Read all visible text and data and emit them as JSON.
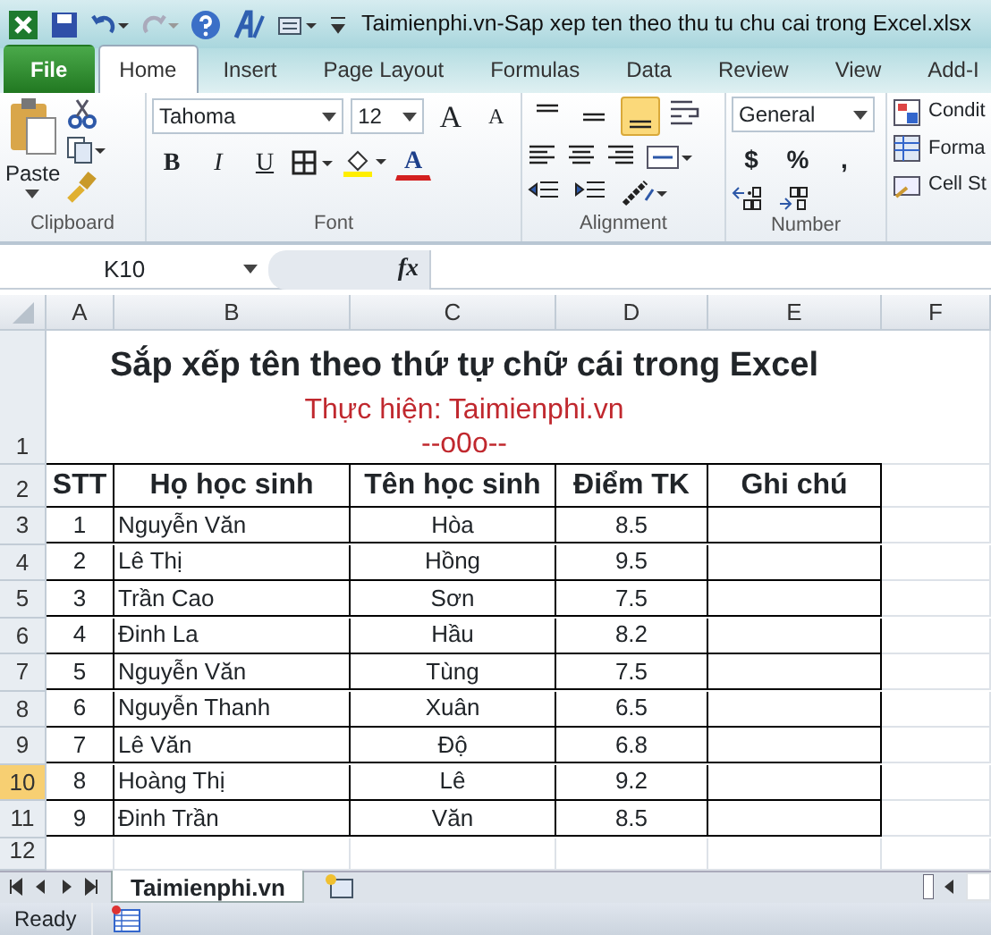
{
  "window": {
    "title": "Taimienphi.vn-Sap xep ten theo thu tu chu cai trong Excel.xlsx"
  },
  "tabs": [
    {
      "label": "File",
      "kind": "file",
      "selected": false
    },
    {
      "label": "Home",
      "kind": "tab",
      "selected": true
    },
    {
      "label": "Insert",
      "kind": "tab",
      "selected": false
    },
    {
      "label": "Page Layout",
      "kind": "tab",
      "selected": false
    },
    {
      "label": "Formulas",
      "kind": "tab",
      "selected": false
    },
    {
      "label": "Data",
      "kind": "tab",
      "selected": false
    },
    {
      "label": "Review",
      "kind": "tab",
      "selected": false
    },
    {
      "label": "View",
      "kind": "tab",
      "selected": false
    },
    {
      "label": "Add-I",
      "kind": "tab",
      "selected": false
    }
  ],
  "ribbon": {
    "clipboard": {
      "label": "Clipboard",
      "paste": "Paste"
    },
    "font": {
      "label": "Font",
      "name": "Tahoma",
      "size": "12",
      "grow": "A",
      "shrink": "A",
      "styles": [
        "B",
        "I",
        "U"
      ],
      "color_letter": "A"
    },
    "alignment": {
      "label": "Alignment",
      "buttons": [
        {
          "selected": false
        },
        {
          "selected": false
        },
        {
          "selected": true
        }
      ]
    },
    "number": {
      "label": "Number",
      "format": "General",
      "buttons": [
        "$",
        "%",
        ","
      ]
    },
    "styles": [
      "Condit",
      "Forma",
      "Cell St"
    ]
  },
  "formula_bar": {
    "name_box": "K10",
    "fx": "fx"
  },
  "columns": [
    "A",
    "B",
    "C",
    "D",
    "E",
    "F"
  ],
  "title_row": {
    "row": "1",
    "title": "Sắp xếp tên theo thứ tự chữ cái trong Excel",
    "subtitle": "Thực hiện: Taimienphi.vn",
    "ornament": "--o0o--"
  },
  "header_row": {
    "row": "2",
    "cells": [
      "STT",
      "Họ học sinh",
      "Tên học sinh",
      "Điểm TK",
      "Ghi chú"
    ]
  },
  "rows": [
    {
      "row": "3",
      "selected": false,
      "cells": [
        "1",
        "Nguyễn Văn",
        "Hòa",
        "8.5"
      ]
    },
    {
      "row": "4",
      "selected": false,
      "cells": [
        "2",
        "Lê Thị",
        "Hồng",
        "9.5"
      ]
    },
    {
      "row": "5",
      "selected": false,
      "cells": [
        "3",
        "Trần Cao",
        "Sơn",
        "7.5"
      ]
    },
    {
      "row": "6",
      "selected": false,
      "cells": [
        "4",
        "Đinh La",
        "Hầu",
        "8.2"
      ]
    },
    {
      "row": "7",
      "selected": false,
      "cells": [
        "5",
        "Nguyễn Văn",
        "Tùng",
        "7.5"
      ]
    },
    {
      "row": "8",
      "selected": false,
      "cells": [
        "6",
        "Nguyễn Thanh",
        "Xuân",
        "6.5"
      ]
    },
    {
      "row": "9",
      "selected": false,
      "cells": [
        "7",
        "Lê Văn",
        "Độ",
        "6.8"
      ]
    },
    {
      "row": "10",
      "selected": true,
      "cells": [
        "8",
        "Hoàng Thị",
        "Lê",
        "9.2"
      ]
    },
    {
      "row": "11",
      "selected": false,
      "cells": [
        "9",
        "Đinh Trần",
        "Văn",
        "8.5"
      ]
    }
  ],
  "empty_rows": [
    "12"
  ],
  "sheet_tabs": [
    {
      "label": "Taimienphi.vn",
      "selected": true
    }
  ],
  "status_bar": {
    "text": "Ready"
  }
}
